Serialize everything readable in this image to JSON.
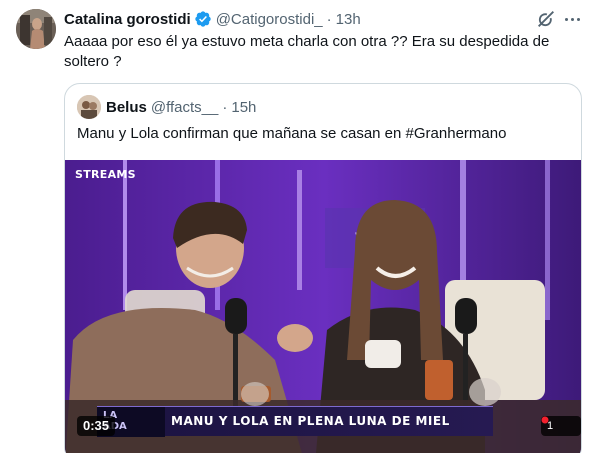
{
  "tweet": {
    "author_name": "Catalina gorostidi",
    "author_handle": "@Catigorostidi_",
    "separator": "·",
    "time": "13h",
    "text": "Aaaaa por eso él ya estuvo meta charla con otra ?? Era su despedida de soltero ?",
    "verified_icon": "verified-badge-icon",
    "grok_icon": "grok-icon",
    "more_icon": "more-dots-icon"
  },
  "quote": {
    "author_name": "Belus",
    "author_handle": "@ffacts__",
    "separator": "·",
    "time": "15h",
    "text": "Manu y Lola confirman que mañana se casan en #Granhermano",
    "video": {
      "channel_logo": "STREAMS",
      "lower_third_brand_line1": "LA",
      "lower_third_brand_line2": "ADA",
      "headline": "MANU Y LOLA EN PLENA LUNA DE MIEL",
      "duration": "0:35",
      "corner_badge": "1"
    }
  },
  "colors": {
    "text_primary": "#0f1419",
    "text_secondary": "#536471",
    "verified_blue": "#1d9bf0",
    "border": "#cfd9de",
    "studio_purple": "#5a2aa8"
  }
}
